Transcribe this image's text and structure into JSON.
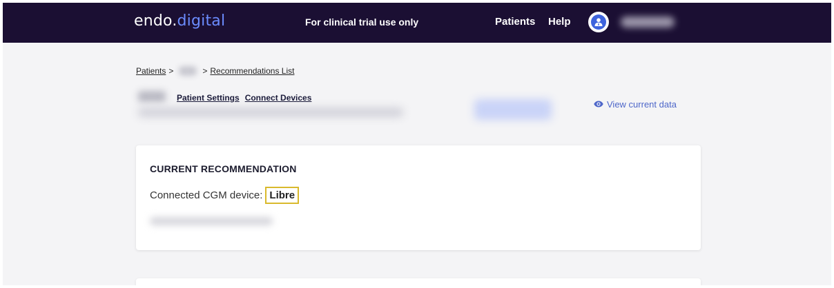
{
  "header": {
    "logo_main": "endo.",
    "logo_accent": "digital",
    "trial_note": "For clinical trial use only",
    "nav": {
      "patients_label": "Patients",
      "help_label": "Help"
    },
    "avatar_icon": "user-doctor-icon"
  },
  "breadcrumb": {
    "patients_label": "Patients",
    "separator_1": ">",
    "separator_2": ">",
    "current_label": "Recommendations List"
  },
  "patient_header": {
    "settings_link": "Patient Settings",
    "devices_link": "Connect Devices",
    "view_data_label": "View current data",
    "view_data_icon": "eye-icon"
  },
  "recommendation": {
    "title": "CURRENT RECOMMENDATION",
    "cgm_label": "Connected CGM device:",
    "cgm_value": "Libre"
  },
  "colors": {
    "topbar": "#1b0f33",
    "accent": "#6b8cff",
    "link_blue": "#4d66c9",
    "highlight": "#d9b92c"
  }
}
